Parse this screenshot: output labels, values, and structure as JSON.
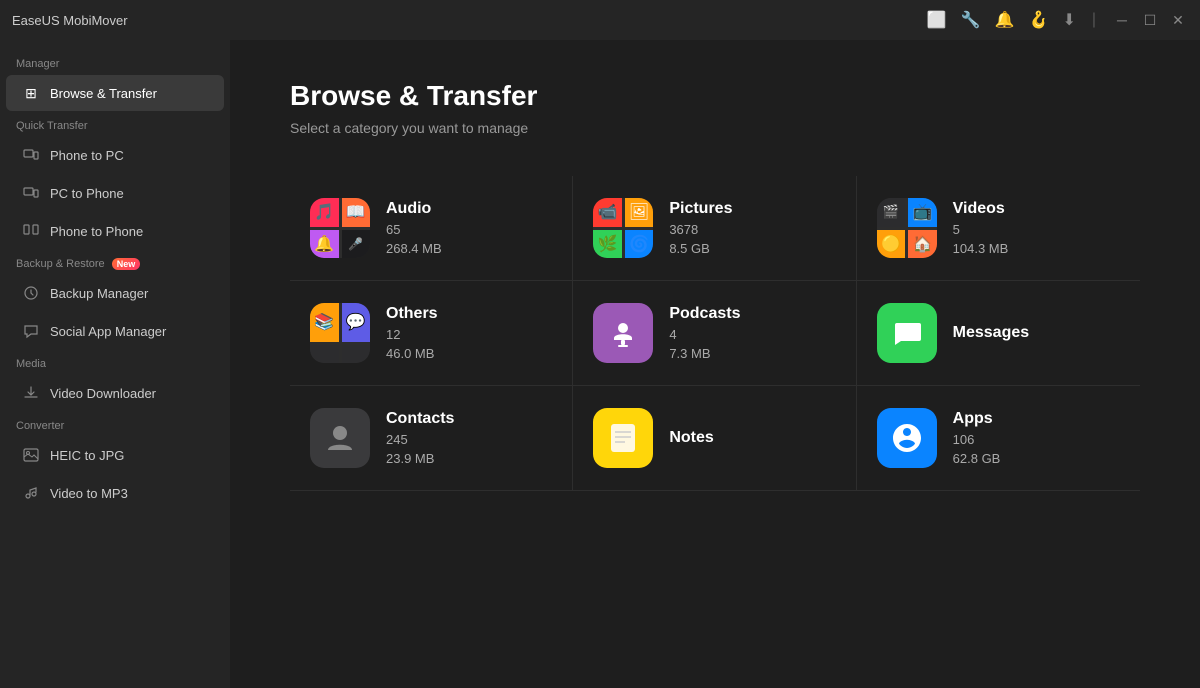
{
  "app": {
    "title": "EaseUS MobiMover"
  },
  "titlebar": {
    "icons": [
      "device",
      "tools",
      "bell",
      "hanger",
      "download",
      "minimize",
      "maximize",
      "close"
    ]
  },
  "sidebar": {
    "manager_label": "Manager",
    "quick_transfer_label": "Quick Transfer",
    "backup_restore_label": "Backup & Restore",
    "media_label": "Media",
    "converter_label": "Converter",
    "items": [
      {
        "id": "browse-transfer",
        "label": "Browse & Transfer",
        "icon": "⊞",
        "active": true,
        "section": "manager"
      },
      {
        "id": "phone-to-pc",
        "label": "Phone to PC",
        "icon": "📱",
        "active": false,
        "section": "quick-transfer"
      },
      {
        "id": "pc-to-phone",
        "label": "PC to Phone",
        "icon": "💻",
        "active": false,
        "section": "quick-transfer"
      },
      {
        "id": "phone-to-phone",
        "label": "Phone to Phone",
        "icon": "📲",
        "active": false,
        "section": "quick-transfer"
      },
      {
        "id": "backup-manager",
        "label": "Backup Manager",
        "icon": "🔄",
        "active": false,
        "section": "backup-restore"
      },
      {
        "id": "social-app-manager",
        "label": "Social App Manager",
        "icon": "💬",
        "active": false,
        "section": "backup-restore"
      },
      {
        "id": "video-downloader",
        "label": "Video Downloader",
        "icon": "⬇",
        "active": false,
        "section": "media"
      },
      {
        "id": "heic-to-jpg",
        "label": "HEIC to JPG",
        "icon": "🖼",
        "active": false,
        "section": "converter"
      },
      {
        "id": "video-to-mp3",
        "label": "Video to MP3",
        "icon": "🎵",
        "active": false,
        "section": "converter"
      }
    ]
  },
  "content": {
    "title": "Browse & Transfer",
    "subtitle": "Select a category you want to manage",
    "categories": [
      {
        "id": "audio",
        "name": "Audio",
        "count": "65",
        "size": "268.4 MB",
        "icon_type": "grid4"
      },
      {
        "id": "pictures",
        "name": "Pictures",
        "count": "3678",
        "size": "8.5 GB",
        "icon_type": "grid4"
      },
      {
        "id": "videos",
        "name": "Videos",
        "count": "5",
        "size": "104.3 MB",
        "icon_type": "grid4"
      },
      {
        "id": "others",
        "name": "Others",
        "count": "12",
        "size": "46.0 MB",
        "icon_type": "grid4"
      },
      {
        "id": "podcasts",
        "name": "Podcasts",
        "count": "4",
        "size": "7.3 MB",
        "icon_type": "single",
        "icon_emoji": "🎙",
        "icon_bg": "podcast-bg"
      },
      {
        "id": "messages",
        "name": "Messages",
        "count": "",
        "size": "",
        "icon_type": "single",
        "icon_emoji": "💬",
        "icon_bg": "messages-bg"
      },
      {
        "id": "contacts",
        "name": "Contacts",
        "count": "245",
        "size": "23.9 MB",
        "icon_type": "single",
        "icon_emoji": "👤",
        "icon_bg": "contacts-bg"
      },
      {
        "id": "notes",
        "name": "Notes",
        "count": "",
        "size": "",
        "icon_type": "single",
        "icon_emoji": "📝",
        "icon_bg": "notes-bg"
      },
      {
        "id": "apps",
        "name": "Apps",
        "count": "106",
        "size": "62.8 GB",
        "icon_type": "single",
        "icon_emoji": "🅰",
        "icon_bg": "apps-bg"
      }
    ]
  }
}
